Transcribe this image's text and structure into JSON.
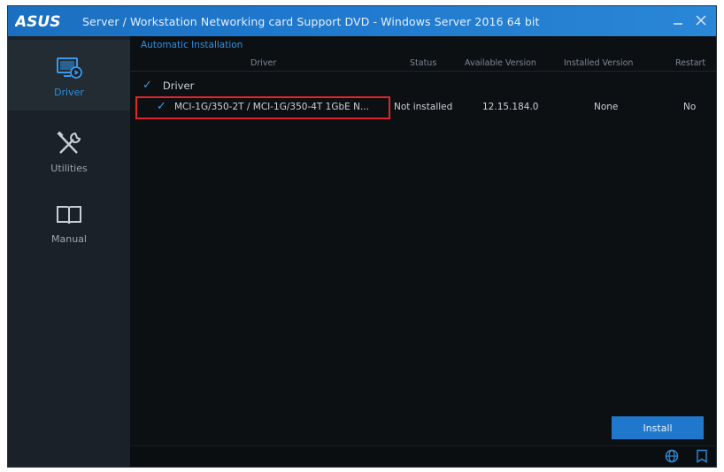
{
  "titlebar": {
    "brand": "ASUS",
    "title": "Server / Workstation  Networking card  Support DVD - Windows Server 2016 64 bit",
    "minimize_icon": "minimize-icon",
    "close_icon": "close-icon"
  },
  "sidebar": {
    "items": [
      {
        "label": "Driver",
        "icon": "driver-monitor-icon",
        "active": true
      },
      {
        "label": "Utilities",
        "icon": "tools-icon",
        "active": false
      },
      {
        "label": "Manual",
        "icon": "book-icon",
        "active": false
      }
    ]
  },
  "main": {
    "section_title": "Automatic Installation",
    "columns": {
      "driver": "Driver",
      "status": "Status",
      "available_version": "Available Version",
      "installed_version": "Installed Version",
      "restart": "Restart"
    },
    "group": {
      "label": "Driver",
      "checked": true
    },
    "rows": [
      {
        "checked": true,
        "driver": "MCI-1G/350-2T / MCI-1G/350-4T 1GbE N...",
        "status": "Not installed",
        "available_version": "12.15.184.0",
        "installed_version": "None",
        "restart": "No"
      }
    ],
    "install_label": "Install"
  },
  "footer": {
    "icons": [
      "globe-icon",
      "bookmark-icon"
    ]
  },
  "colors": {
    "accent": "#1f78cc",
    "highlight": "#e0262c",
    "background": "#0d1013",
    "sidebar": "#1b2128"
  }
}
